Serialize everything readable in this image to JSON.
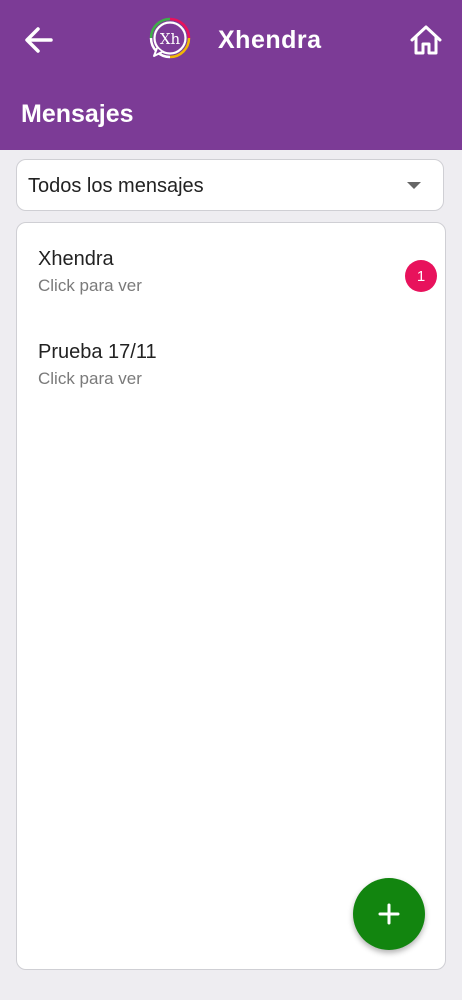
{
  "appbar": {
    "brand": "Xhendra",
    "logo_text": "Xh",
    "title": "Mensajes",
    "back_icon": "arrow-left-icon",
    "home_icon": "home-icon"
  },
  "filter": {
    "selected": "Todos los mensajes"
  },
  "messages": [
    {
      "title": "Xhendra",
      "subtitle": "Click para ver",
      "unread": "1"
    },
    {
      "title": "Prueba 17/11",
      "subtitle": "Click para ver"
    }
  ],
  "fab": {
    "icon": "plus-icon"
  },
  "colors": {
    "primary": "#7c3b96",
    "badge": "#e8125c",
    "fab": "#12850f",
    "background": "#eeedf1"
  }
}
